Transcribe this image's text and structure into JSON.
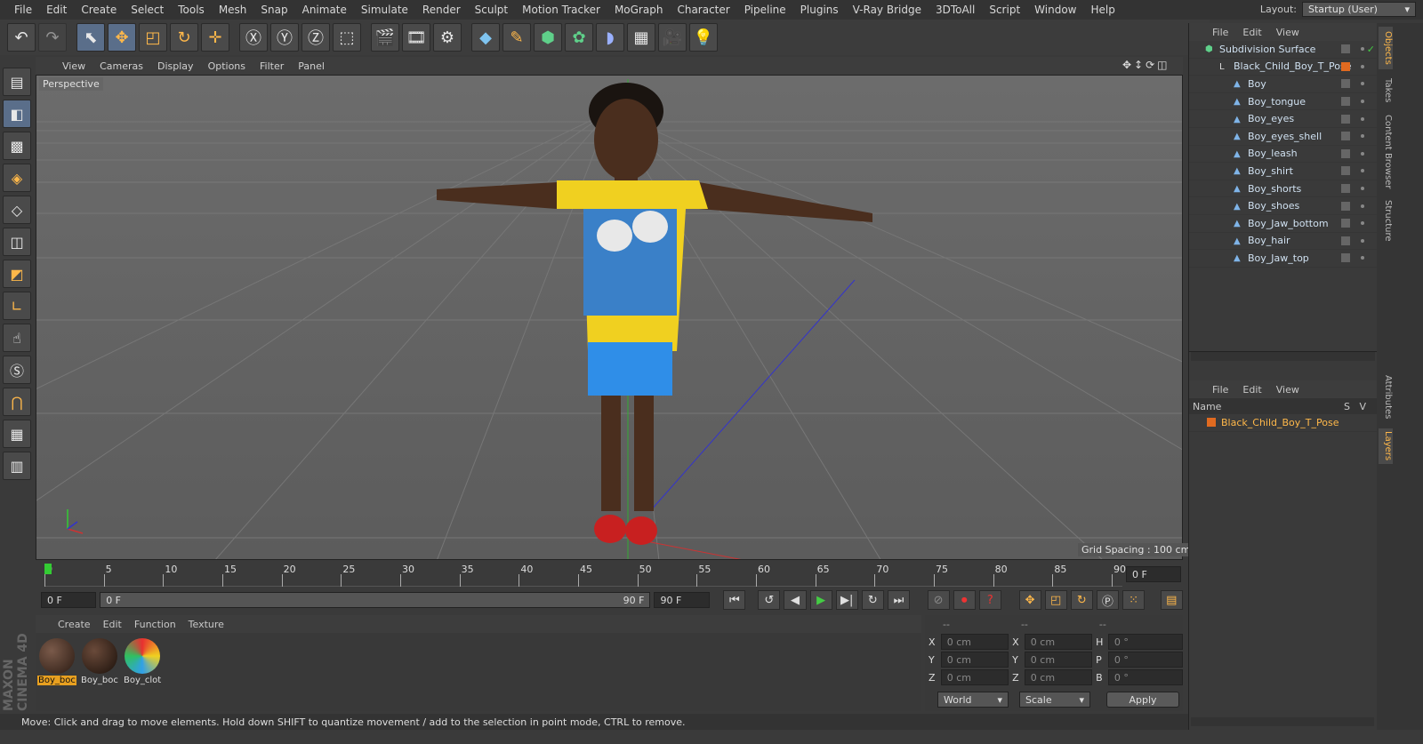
{
  "menu": [
    "File",
    "Edit",
    "Create",
    "Select",
    "Tools",
    "Mesh",
    "Snap",
    "Animate",
    "Simulate",
    "Render",
    "Sculpt",
    "Motion Tracker",
    "MoGraph",
    "Character",
    "Pipeline",
    "Plugins",
    "V-Ray Bridge",
    "3DToAll",
    "Script",
    "Window",
    "Help"
  ],
  "layout": {
    "label": "Layout:",
    "value": "Startup (User)"
  },
  "toolbar_icons": [
    "undo-icon",
    "redo-icon",
    "select-arrow-icon",
    "move-icon",
    "scale-icon",
    "rotate-icon",
    "recent-tool-icon",
    "x-axis-icon",
    "y-axis-icon",
    "z-axis-icon",
    "coordinate-system-icon",
    "render-view-icon",
    "render-picture-viewer-icon",
    "render-settings-icon",
    "cube-icon",
    "pen-icon",
    "subdivision-icon",
    "mograph-icon",
    "deformer-icon",
    "scene-icon",
    "camera-icon",
    "light-icon"
  ],
  "viewport": {
    "menu": [
      "View",
      "Cameras",
      "Display",
      "Options",
      "Filter",
      "Panel"
    ],
    "label": "Perspective",
    "grid_spacing": "Grid Spacing : 100 cm"
  },
  "timeline": {
    "ticks": [
      "0",
      "5",
      "10",
      "15",
      "20",
      "25",
      "30",
      "35",
      "40",
      "45",
      "50",
      "55",
      "60",
      "65",
      "70",
      "75",
      "80",
      "85",
      "90"
    ],
    "current_frame": "0 F"
  },
  "transport": {
    "start": "0 F",
    "slider_start": "0 F",
    "slider_end": "90 F",
    "end": "90 F"
  },
  "materials": {
    "menu": [
      "Create",
      "Edit",
      "Function",
      "Texture"
    ],
    "items": [
      {
        "name": "Boy_boc",
        "selected": true
      },
      {
        "name": "Boy_boc",
        "selected": false
      },
      {
        "name": "Boy_clot",
        "selected": false
      }
    ]
  },
  "coords": {
    "header": [
      "--",
      "--",
      "--"
    ],
    "rows": [
      {
        "a": "X",
        "av": "0 cm",
        "b": "X",
        "bv": "0 cm",
        "c": "H",
        "cv": "0 °"
      },
      {
        "a": "Y",
        "av": "0 cm",
        "b": "Y",
        "bv": "0 cm",
        "c": "P",
        "cv": "0 °"
      },
      {
        "a": "Z",
        "av": "0 cm",
        "b": "Z",
        "bv": "0 cm",
        "c": "B",
        "cv": "0 °"
      }
    ],
    "mode": "World",
    "scale": "Scale",
    "apply": "Apply"
  },
  "status": "Move: Click and drag to move elements. Hold down SHIFT to quantize movement / add to the selection in point mode, CTRL to remove.",
  "objects": {
    "menu": [
      "File",
      "Edit",
      "View"
    ],
    "items": [
      {
        "name": "Subdivision Surface",
        "level": 0
      },
      {
        "name": "Black_Child_Boy_T_Pose",
        "level": 1
      },
      {
        "name": "Boy",
        "level": 2
      },
      {
        "name": "Boy_tongue",
        "level": 2
      },
      {
        "name": "Boy_eyes",
        "level": 2
      },
      {
        "name": "Boy_eyes_shell",
        "level": 2
      },
      {
        "name": "Boy_leash",
        "level": 2
      },
      {
        "name": "Boy_shirt",
        "level": 2
      },
      {
        "name": "Boy_shorts",
        "level": 2
      },
      {
        "name": "Boy_shoes",
        "level": 2
      },
      {
        "name": "Boy_Jaw_bottom",
        "level": 2
      },
      {
        "name": "Boy_hair",
        "level": 2
      },
      {
        "name": "Boy_Jaw_top",
        "level": 2
      }
    ]
  },
  "layers": {
    "menu": [
      "File",
      "Edit",
      "View"
    ],
    "columns": [
      "Name",
      "S",
      "V"
    ],
    "items": [
      {
        "name": "Black_Child_Boy_T_Pose"
      }
    ]
  },
  "side_tabs": [
    "Objects",
    "Takes",
    "Content Browser",
    "Structure",
    "Attributes",
    "Layers"
  ],
  "brand": "MAXON CINEMA 4D"
}
